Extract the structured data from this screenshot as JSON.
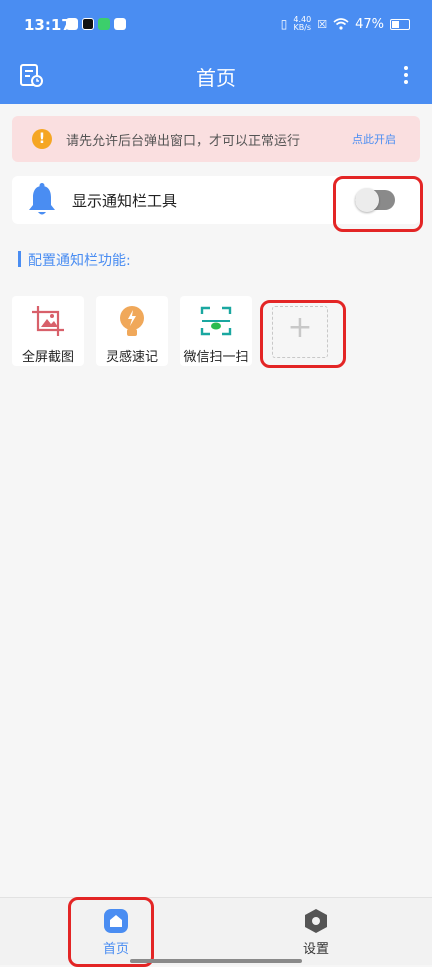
{
  "status_bar": {
    "time": "13:17",
    "speed_value": "4.40",
    "speed_unit": "KB/s",
    "battery": "47%"
  },
  "app_bar": {
    "title": "首页"
  },
  "alert": {
    "message": "请先允许后台弹出窗口，才可以正常运行",
    "action": "点此开启",
    "icon": "!"
  },
  "notification_toggle": {
    "label": "显示通知栏工具",
    "enabled": false
  },
  "section": {
    "title": "配置通知栏功能:"
  },
  "tools": [
    {
      "label": "全屏截图",
      "icon": "screenshot-icon"
    },
    {
      "label": "灵感速记",
      "icon": "lightbulb-icon"
    },
    {
      "label": "微信扫一扫",
      "icon": "wechat-scan-icon"
    }
  ],
  "add_tile": {
    "symbol": "+"
  },
  "bottom_nav": {
    "items": [
      {
        "label": "首页",
        "icon": "home-icon",
        "active": true
      },
      {
        "label": "设置",
        "icon": "settings-icon",
        "active": false
      }
    ]
  },
  "colors": {
    "primary": "#4a8df2",
    "alert_bg": "#fadfe0",
    "warning": "#f5a623",
    "highlight": "#e32525"
  }
}
